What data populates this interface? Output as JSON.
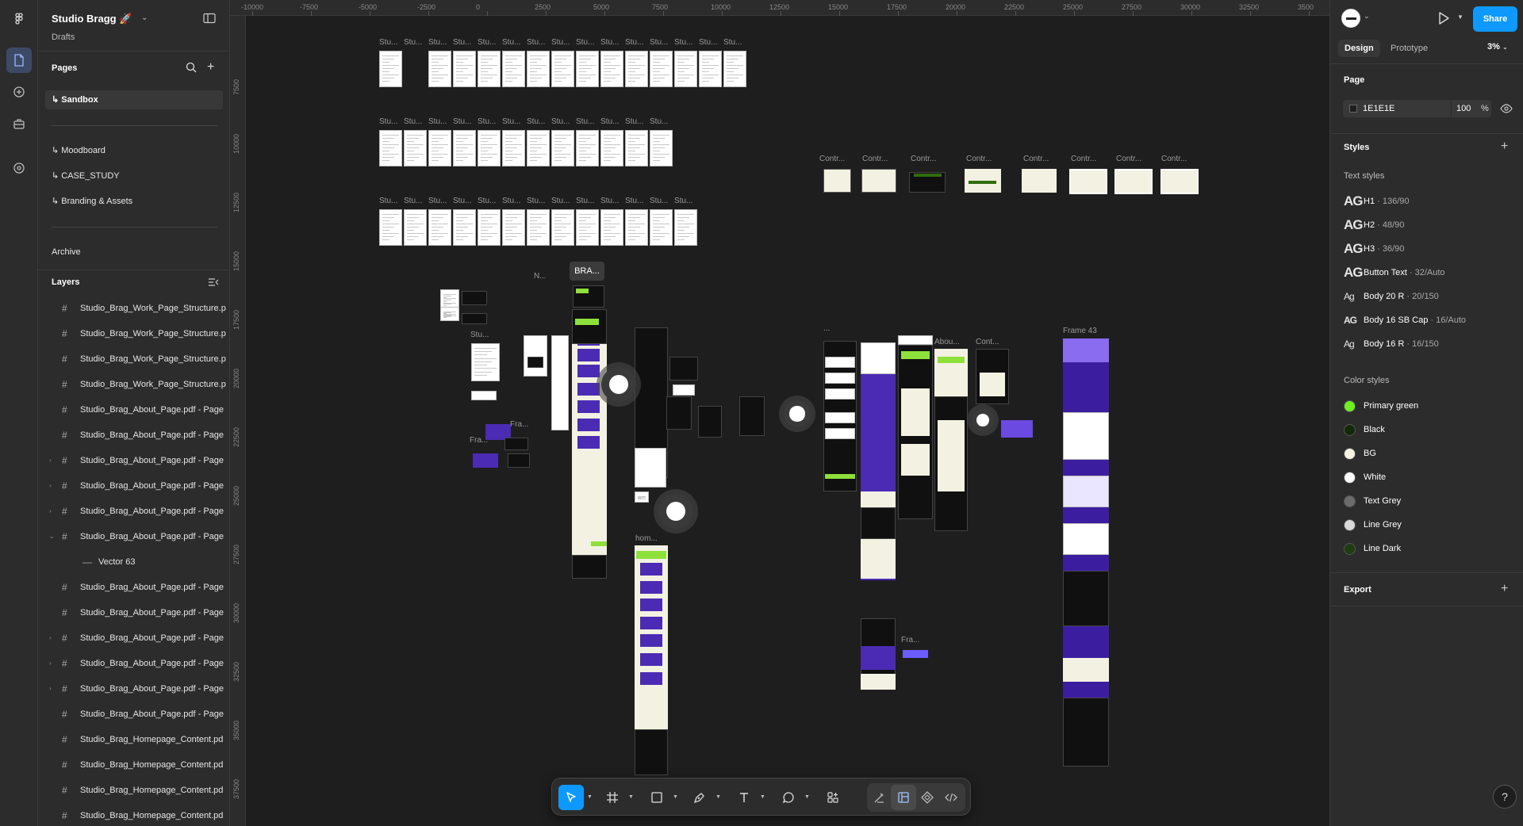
{
  "file": {
    "name": "Studio Bragg 🚀",
    "location": "Drafts"
  },
  "pages": {
    "header": "Pages",
    "items": [
      {
        "label": "↳ Sandbox",
        "selected": true
      },
      {
        "label": "↳ Moodboard"
      },
      {
        "label": "↳ CASE_STUDY"
      },
      {
        "label": "↳ Branding & Assets"
      },
      {
        "label": "Archive"
      }
    ]
  },
  "layers": {
    "header": "Layers",
    "items": [
      {
        "name": "Studio_Brag_Work_Page_Structure.p",
        "caret": ""
      },
      {
        "name": "Studio_Brag_Work_Page_Structure.p",
        "caret": ""
      },
      {
        "name": "Studio_Brag_Work_Page_Structure.p",
        "caret": ""
      },
      {
        "name": "Studio_Brag_Work_Page_Structure.p",
        "caret": ""
      },
      {
        "name": "Studio_Brag_About_Page.pdf - Page",
        "caret": ""
      },
      {
        "name": "Studio_Brag_About_Page.pdf - Page",
        "caret": ""
      },
      {
        "name": "Studio_Brag_About_Page.pdf - Page",
        "caret": "›"
      },
      {
        "name": "Studio_Brag_About_Page.pdf - Page",
        "caret": "›"
      },
      {
        "name": "Studio_Brag_About_Page.pdf - Page",
        "caret": "›"
      },
      {
        "name": "Studio_Brag_About_Page.pdf - Page",
        "caret": "⌄"
      },
      {
        "name": "Vector 63",
        "caret": "",
        "child": true
      },
      {
        "name": "Studio_Brag_About_Page.pdf - Page",
        "caret": ""
      },
      {
        "name": "Studio_Brag_About_Page.pdf - Page",
        "caret": ""
      },
      {
        "name": "Studio_Brag_About_Page.pdf - Page",
        "caret": "›"
      },
      {
        "name": "Studio_Brag_About_Page.pdf - Page",
        "caret": "›"
      },
      {
        "name": "Studio_Brag_About_Page.pdf - Page",
        "caret": "›"
      },
      {
        "name": "Studio_Brag_About_Page.pdf - Page",
        "caret": ""
      },
      {
        "name": "Studio_Brag_Homepage_Content.pd",
        "caret": ""
      },
      {
        "name": "Studio_Brag_Homepage_Content.pd",
        "caret": ""
      },
      {
        "name": "Studio_Brag_Homepage_Content.pd",
        "caret": ""
      },
      {
        "name": "Studio_Brag_Homepage_Content.pd",
        "caret": ""
      }
    ]
  },
  "ruler": {
    "top": [
      "-10000",
      "-7500",
      "-5000",
      "-2500",
      "0",
      "2500",
      "5000",
      "7500",
      "10000",
      "12500",
      "15000",
      "17500",
      "20000",
      "22500",
      "25000",
      "27500",
      "30000",
      "32500",
      "3500"
    ],
    "left": [
      "7500",
      "10000",
      "12500",
      "15000",
      "17500",
      "20000",
      "22500",
      "25000",
      "27500",
      "30000",
      "32500",
      "35000",
      "37500"
    ]
  },
  "canvas": {
    "labels": {
      "stu": "Stu...",
      "contr": "Contr...",
      "bra": "BRA...",
      "n": "N...",
      "about": "Abou...",
      "cont": "Cont...",
      "frame43": "Frame 43",
      "hom": "hom...",
      "fra": "Fra...",
      "ellipsis": "..."
    }
  },
  "right": {
    "share": "Share",
    "tabs": {
      "design": "Design",
      "prototype": "Prototype"
    },
    "zoom": "3%",
    "page": {
      "header": "Page",
      "color": "1E1E1E",
      "opacity": "100",
      "unit": "%"
    },
    "styles": {
      "header": "Styles",
      "text_header": "Text styles",
      "text_styles": [
        {
          "name": "H1",
          "meta": " · 136/90",
          "glyph": "AG"
        },
        {
          "name": "H2",
          "meta": " · 48/90",
          "glyph": "AG"
        },
        {
          "name": "H3",
          "meta": " · 36/90",
          "glyph": "AG"
        },
        {
          "name": "Button Text",
          "meta": " · 32/Auto",
          "glyph": "AG"
        },
        {
          "name": "Body 20 R",
          "meta": " · 20/150",
          "glyph": "Ag"
        },
        {
          "name": "Body 16 SB Cap",
          "meta": " · 16/Auto",
          "glyph": "AG"
        },
        {
          "name": "Body 16 R",
          "meta": " · 16/150",
          "glyph": "Ag"
        }
      ],
      "color_header": "Color styles",
      "color_styles": [
        {
          "name": "Primary green",
          "color": "#6ef01f"
        },
        {
          "name": "Black",
          "color": "#132a0a"
        },
        {
          "name": "BG",
          "color": "#f6f3e4"
        },
        {
          "name": "White",
          "color": "#ffffff"
        },
        {
          "name": "Text Grey",
          "color": "#6b6b6b"
        },
        {
          "name": "Line Grey",
          "color": "#d9d9d9"
        },
        {
          "name": "Line Dark",
          "color": "#1f3b12"
        }
      ]
    },
    "export": {
      "header": "Export"
    },
    "help": "?"
  },
  "colors": {
    "accent": "#0d99ff",
    "canvas_bg": "#1e1e1e",
    "panel_bg": "#2c2c2c"
  }
}
